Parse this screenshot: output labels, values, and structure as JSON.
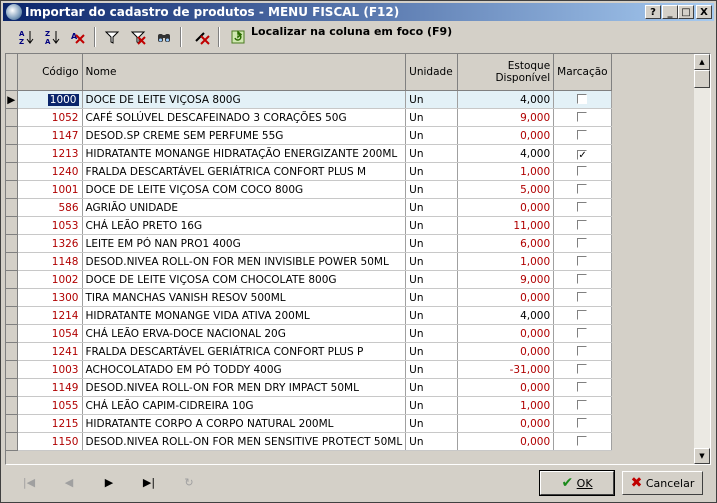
{
  "window": {
    "title": "Importar do cadastro de produtos - MENU FISCAL (F12)",
    "help_btn": "?",
    "min_btn": "_",
    "max_btn": "□",
    "close_btn": "X"
  },
  "toolbar": {
    "find_label": "Localizar na coluna em foco (F9)"
  },
  "grid": {
    "columns": {
      "code": "Código",
      "name": "Nome",
      "unit": "Unidade",
      "stock_1": "Estoque",
      "stock_2": "Disponível",
      "mark": "Marcação"
    },
    "rows": [
      {
        "code": "1000",
        "name": "DOCE DE LEITE VIÇOSA 800G",
        "unit": "Un",
        "stock": "4,000",
        "checked": false,
        "selected": true
      },
      {
        "code": "1052",
        "name": "CAFÉ SOLÚVEL DESCAFEINADO 3 CORAÇÕES 50G",
        "unit": "Un",
        "stock": "9,000",
        "checked": false,
        "selected": false
      },
      {
        "code": "1147",
        "name": "DESOD.SP CREME SEM PERFUME 55G",
        "unit": "Un",
        "stock": "0,000",
        "checked": false,
        "selected": false
      },
      {
        "code": "1213",
        "name": "HIDRATANTE MONANGE HIDRATAÇÃO ENERGIZANTE 200ML",
        "unit": "Un",
        "stock": "4,000",
        "checked": true,
        "selected": false
      },
      {
        "code": "1240",
        "name": "FRALDA DESCARTÁVEL GERIÁTRICA CONFORT PLUS M",
        "unit": "Un",
        "stock": "1,000",
        "checked": false,
        "selected": false
      },
      {
        "code": "1001",
        "name": "DOCE DE LEITE VIÇOSA COM COCO 800G",
        "unit": "Un",
        "stock": "5,000",
        "checked": false,
        "selected": false
      },
      {
        "code": "586",
        "name": "AGRIÃO UNIDADE",
        "unit": "Un",
        "stock": "0,000",
        "checked": false,
        "selected": false
      },
      {
        "code": "1053",
        "name": "CHÁ LEÃO PRETO 16G",
        "unit": "Un",
        "stock": "11,000",
        "checked": false,
        "selected": false
      },
      {
        "code": "1326",
        "name": "LEITE EM PÓ NAN PRO1 400G",
        "unit": "Un",
        "stock": "6,000",
        "checked": false,
        "selected": false
      },
      {
        "code": "1148",
        "name": "DESOD.NIVEA ROLL-ON FOR MEN INVISIBLE POWER 50ML",
        "unit": "Un",
        "stock": "1,000",
        "checked": false,
        "selected": false
      },
      {
        "code": "1002",
        "name": "DOCE DE LEITE VIÇOSA COM CHOCOLATE 800G",
        "unit": "Un",
        "stock": "9,000",
        "checked": false,
        "selected": false
      },
      {
        "code": "1300",
        "name": "TIRA MANCHAS VANISH RESOV 500ML",
        "unit": "Un",
        "stock": "0,000",
        "checked": false,
        "selected": false
      },
      {
        "code": "1214",
        "name": "HIDRATANTE MONANGE VIDA ATIVA 200ML",
        "unit": "Un",
        "stock": "4,000",
        "checked": false,
        "selected": false
      },
      {
        "code": "1054",
        "name": "CHÁ LEÃO ERVA-DOCE NACIONAL 20G",
        "unit": "Un",
        "stock": "0,000",
        "checked": false,
        "selected": false
      },
      {
        "code": "1241",
        "name": "FRALDA DESCARTÁVEL GERIÁTRICA CONFORT PLUS P",
        "unit": "Un",
        "stock": "0,000",
        "checked": false,
        "selected": false
      },
      {
        "code": "1003",
        "name": "ACHOCOLATADO EM PÓ TODDY 400G",
        "unit": "Un",
        "stock": "-31,000",
        "checked": false,
        "selected": false
      },
      {
        "code": "1149",
        "name": "DESOD.NIVEA ROLL-ON FOR MEN DRY IMPACT 50ML",
        "unit": "Un",
        "stock": "0,000",
        "checked": false,
        "selected": false
      },
      {
        "code": "1055",
        "name": "CHÁ LEÃO CAPIM-CIDREIRA 10G",
        "unit": "Un",
        "stock": "1,000",
        "checked": false,
        "selected": false
      },
      {
        "code": "1215",
        "name": "HIDRATANTE CORPO A CORPO NATURAL 200ML",
        "unit": "Un",
        "stock": "0,000",
        "checked": false,
        "selected": false
      },
      {
        "code": "1150",
        "name": "DESOD.NIVEA ROLL-ON FOR MEN SENSITIVE PROTECT 50ML",
        "unit": "Un",
        "stock": "0,000",
        "checked": false,
        "selected": false
      }
    ]
  },
  "buttons": {
    "ok": "OK",
    "cancel": "Cancelar"
  },
  "colors": {
    "title_start": "#0a246a",
    "title_end": "#a6caf0",
    "code_text": "#b00000",
    "selected_row": "#e3f1f7"
  }
}
